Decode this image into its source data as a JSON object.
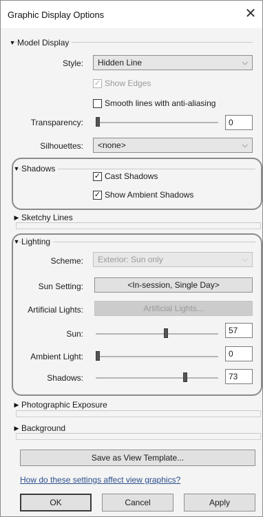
{
  "window": {
    "title": "Graphic Display Options",
    "close_symbol": "✕"
  },
  "model_display": {
    "header": "Model Display",
    "style_label": "Style:",
    "style_value": "Hidden Line",
    "show_edges_label": "Show Edges",
    "show_edges_checked": true,
    "smooth_lines_label": "Smooth lines with anti-aliasing",
    "smooth_lines_checked": false,
    "transparency_label": "Transparency:",
    "transparency_value": "0",
    "silhouettes_label": "Silhouettes:",
    "silhouettes_value": "<none>"
  },
  "shadows": {
    "header": "Shadows",
    "cast_shadows_label": "Cast Shadows",
    "cast_shadows_checked": true,
    "ambient_shadows_label": "Show Ambient Shadows",
    "ambient_shadows_checked": true
  },
  "sketchy_lines": {
    "header": "Sketchy Lines"
  },
  "lighting": {
    "header": "Lighting",
    "scheme_label": "Scheme:",
    "scheme_value": "Exterior: Sun only",
    "sun_setting_label": "Sun Setting:",
    "sun_setting_button": "<In-session, Single Day>",
    "artificial_lights_label": "Artificial Lights:",
    "artificial_lights_button": "Artificial Lights...",
    "sun_label": "Sun:",
    "sun_value": "57",
    "ambient_light_label": "Ambient Light:",
    "ambient_light_value": "0",
    "shadows_label": "Shadows:",
    "shadows_value": "73"
  },
  "photographic_exposure": {
    "header": "Photographic Exposure"
  },
  "background": {
    "header": "Background"
  },
  "footer": {
    "save_template_button": "Save as View Template...",
    "help_link": "How do these settings affect view graphics?",
    "ok_button": "OK",
    "cancel_button": "Cancel",
    "apply_button": "Apply"
  },
  "icons": {
    "expanded": "expanded-triangle-icon",
    "collapsed": "collapsed-triangle-icon",
    "dropdown": "chevron-down-icon",
    "check": "checkmark-icon",
    "close": "close-icon"
  }
}
